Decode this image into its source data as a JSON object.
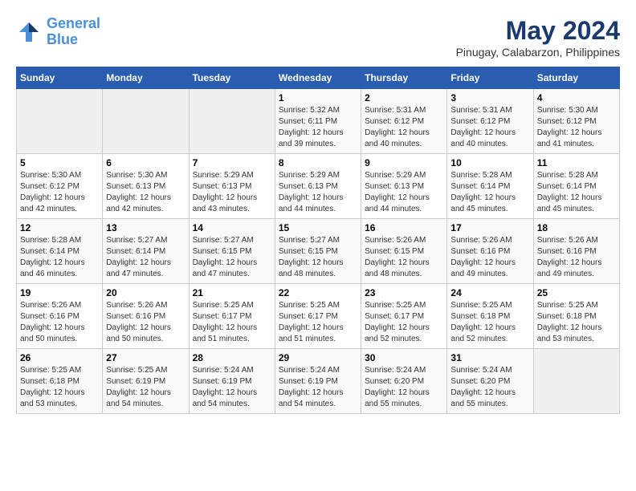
{
  "header": {
    "logo_line1": "General",
    "logo_line2": "Blue",
    "title": "May 2024",
    "subtitle": "Pinugay, Calabarzon, Philippines"
  },
  "weekdays": [
    "Sunday",
    "Monday",
    "Tuesday",
    "Wednesday",
    "Thursday",
    "Friday",
    "Saturday"
  ],
  "weeks": [
    [
      {
        "day": "",
        "info": ""
      },
      {
        "day": "",
        "info": ""
      },
      {
        "day": "",
        "info": ""
      },
      {
        "day": "1",
        "info": "Sunrise: 5:32 AM\nSunset: 6:11 PM\nDaylight: 12 hours\nand 39 minutes."
      },
      {
        "day": "2",
        "info": "Sunrise: 5:31 AM\nSunset: 6:12 PM\nDaylight: 12 hours\nand 40 minutes."
      },
      {
        "day": "3",
        "info": "Sunrise: 5:31 AM\nSunset: 6:12 PM\nDaylight: 12 hours\nand 40 minutes."
      },
      {
        "day": "4",
        "info": "Sunrise: 5:30 AM\nSunset: 6:12 PM\nDaylight: 12 hours\nand 41 minutes."
      }
    ],
    [
      {
        "day": "5",
        "info": "Sunrise: 5:30 AM\nSunset: 6:12 PM\nDaylight: 12 hours\nand 42 minutes."
      },
      {
        "day": "6",
        "info": "Sunrise: 5:30 AM\nSunset: 6:13 PM\nDaylight: 12 hours\nand 42 minutes."
      },
      {
        "day": "7",
        "info": "Sunrise: 5:29 AM\nSunset: 6:13 PM\nDaylight: 12 hours\nand 43 minutes."
      },
      {
        "day": "8",
        "info": "Sunrise: 5:29 AM\nSunset: 6:13 PM\nDaylight: 12 hours\nand 44 minutes."
      },
      {
        "day": "9",
        "info": "Sunrise: 5:29 AM\nSunset: 6:13 PM\nDaylight: 12 hours\nand 44 minutes."
      },
      {
        "day": "10",
        "info": "Sunrise: 5:28 AM\nSunset: 6:14 PM\nDaylight: 12 hours\nand 45 minutes."
      },
      {
        "day": "11",
        "info": "Sunrise: 5:28 AM\nSunset: 6:14 PM\nDaylight: 12 hours\nand 45 minutes."
      }
    ],
    [
      {
        "day": "12",
        "info": "Sunrise: 5:28 AM\nSunset: 6:14 PM\nDaylight: 12 hours\nand 46 minutes."
      },
      {
        "day": "13",
        "info": "Sunrise: 5:27 AM\nSunset: 6:14 PM\nDaylight: 12 hours\nand 47 minutes."
      },
      {
        "day": "14",
        "info": "Sunrise: 5:27 AM\nSunset: 6:15 PM\nDaylight: 12 hours\nand 47 minutes."
      },
      {
        "day": "15",
        "info": "Sunrise: 5:27 AM\nSunset: 6:15 PM\nDaylight: 12 hours\nand 48 minutes."
      },
      {
        "day": "16",
        "info": "Sunrise: 5:26 AM\nSunset: 6:15 PM\nDaylight: 12 hours\nand 48 minutes."
      },
      {
        "day": "17",
        "info": "Sunrise: 5:26 AM\nSunset: 6:16 PM\nDaylight: 12 hours\nand 49 minutes."
      },
      {
        "day": "18",
        "info": "Sunrise: 5:26 AM\nSunset: 6:16 PM\nDaylight: 12 hours\nand 49 minutes."
      }
    ],
    [
      {
        "day": "19",
        "info": "Sunrise: 5:26 AM\nSunset: 6:16 PM\nDaylight: 12 hours\nand 50 minutes."
      },
      {
        "day": "20",
        "info": "Sunrise: 5:26 AM\nSunset: 6:16 PM\nDaylight: 12 hours\nand 50 minutes."
      },
      {
        "day": "21",
        "info": "Sunrise: 5:25 AM\nSunset: 6:17 PM\nDaylight: 12 hours\nand 51 minutes."
      },
      {
        "day": "22",
        "info": "Sunrise: 5:25 AM\nSunset: 6:17 PM\nDaylight: 12 hours\nand 51 minutes."
      },
      {
        "day": "23",
        "info": "Sunrise: 5:25 AM\nSunset: 6:17 PM\nDaylight: 12 hours\nand 52 minutes."
      },
      {
        "day": "24",
        "info": "Sunrise: 5:25 AM\nSunset: 6:18 PM\nDaylight: 12 hours\nand 52 minutes."
      },
      {
        "day": "25",
        "info": "Sunrise: 5:25 AM\nSunset: 6:18 PM\nDaylight: 12 hours\nand 53 minutes."
      }
    ],
    [
      {
        "day": "26",
        "info": "Sunrise: 5:25 AM\nSunset: 6:18 PM\nDaylight: 12 hours\nand 53 minutes."
      },
      {
        "day": "27",
        "info": "Sunrise: 5:25 AM\nSunset: 6:19 PM\nDaylight: 12 hours\nand 54 minutes."
      },
      {
        "day": "28",
        "info": "Sunrise: 5:24 AM\nSunset: 6:19 PM\nDaylight: 12 hours\nand 54 minutes."
      },
      {
        "day": "29",
        "info": "Sunrise: 5:24 AM\nSunset: 6:19 PM\nDaylight: 12 hours\nand 54 minutes."
      },
      {
        "day": "30",
        "info": "Sunrise: 5:24 AM\nSunset: 6:20 PM\nDaylight: 12 hours\nand 55 minutes."
      },
      {
        "day": "31",
        "info": "Sunrise: 5:24 AM\nSunset: 6:20 PM\nDaylight: 12 hours\nand 55 minutes."
      },
      {
        "day": "",
        "info": ""
      }
    ]
  ]
}
